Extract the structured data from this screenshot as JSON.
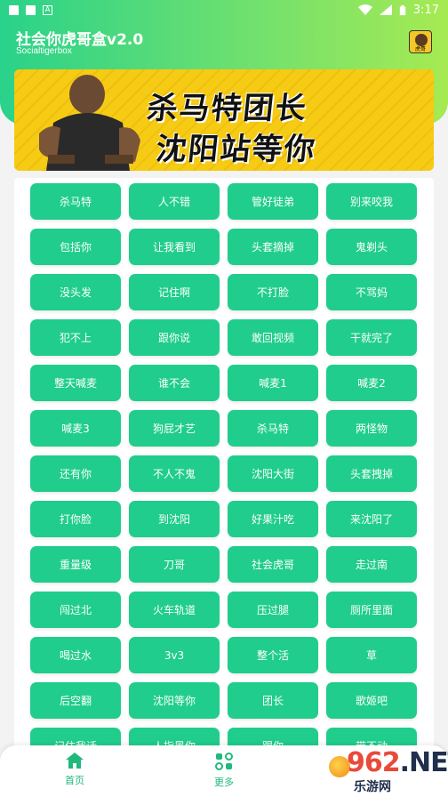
{
  "status_bar": {
    "time": "3:17",
    "notification_glyph": "A"
  },
  "header": {
    "title": "社会你虎哥盒v2.0",
    "subtitle": "Socialtigerbox",
    "brand_colors": {
      "start": "#29d28a",
      "end": "#a6ea52"
    },
    "app_icon_label": "虎哥"
  },
  "banner": {
    "line1": "杀马特团长",
    "line2": "沈阳站等你",
    "background": "#f5ca13"
  },
  "buttons": [
    "杀马特",
    "人不错",
    "管好徒弟",
    "别来咬我",
    "包括你",
    "让我看到",
    "头套摘掉",
    "鬼剃头",
    "没头发",
    "记住啊",
    "不打脸",
    "不骂妈",
    "犯不上",
    "跟你说",
    "敢回视频",
    "干就完了",
    "整天喊麦",
    "谁不会",
    "喊麦1",
    "喊麦2",
    "喊麦3",
    "狗屁才艺",
    "杀马特",
    "两怪物",
    "还有你",
    "不人不鬼",
    "沈阳大街",
    "头套拽掉",
    "打你脸",
    "到沈阳",
    "好果汁吃",
    "来沈阳了",
    "重量级",
    "刀哥",
    "社会虎哥",
    "走过南",
    "闯过北",
    "火车轨道",
    "压过腿",
    "厕所里面",
    "喝过水",
    "3v3",
    "整个活",
    "草",
    "后空翻",
    "沈阳等你",
    "团长",
    "歌姬吧",
    "记住我话",
    "人指黑你",
    "踢你",
    "带不动"
  ],
  "button_color": "#20cd8c",
  "bottom_nav": {
    "home": {
      "label": "首页",
      "icon": "home-icon"
    },
    "more": {
      "label": "更多",
      "icon": "grid-dots-icon"
    }
  },
  "watermark": {
    "brand": "962",
    "suffix": ".NET",
    "sub": "乐游网"
  }
}
